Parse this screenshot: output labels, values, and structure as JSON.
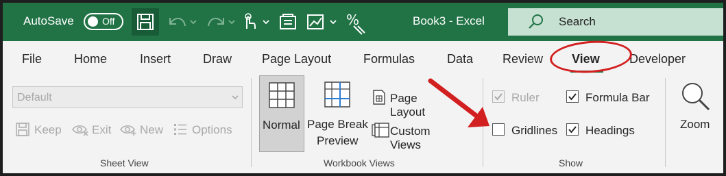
{
  "titlebar": {
    "autosave_label": "AutoSave",
    "autosave_state": "Off",
    "doc_title": "Book3  -  Excel",
    "search_placeholder": "Search"
  },
  "tabs": {
    "file": "File",
    "home": "Home",
    "insert": "Insert",
    "draw": "Draw",
    "page_layout": "Page Layout",
    "formulas": "Formulas",
    "data": "Data",
    "review": "Review",
    "view": "View",
    "developer": "Developer"
  },
  "sheet_view": {
    "dropdown_value": "Default",
    "keep": "Keep",
    "exit": "Exit",
    "new": "New",
    "options": "Options",
    "group_label": "Sheet View"
  },
  "workbook_views": {
    "normal": "Normal",
    "page_break_line1": "Page Break",
    "page_break_line2": "Preview",
    "page_layout": "Page Layout",
    "custom_views": "Custom Views",
    "group_label": "Workbook Views"
  },
  "show": {
    "ruler": "Ruler",
    "formula_bar": "Formula Bar",
    "gridlines": "Gridlines",
    "headings": "Headings",
    "ruler_checked": true,
    "formula_bar_checked": true,
    "gridlines_checked": false,
    "headings_checked": true,
    "group_label": "Show"
  },
  "zoom": {
    "label": "Zoom"
  },
  "colors": {
    "accent": "#217346",
    "annotation": "#d21f1f"
  }
}
